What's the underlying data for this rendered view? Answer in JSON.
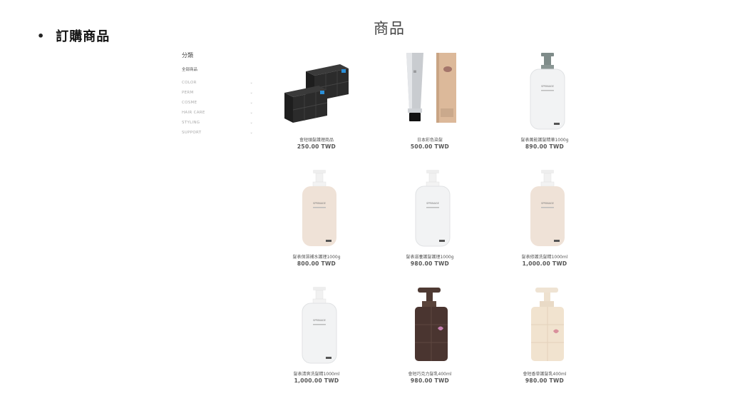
{
  "heading": {
    "bullet": "•",
    "text": "訂購商品"
  },
  "page_title": "商品",
  "sidebar": {
    "title": "分類",
    "all_label": "全部商品",
    "items": [
      {
        "label": "COLOR"
      },
      {
        "label": "PERM"
      },
      {
        "label": "COSME"
      },
      {
        "label": "HAIR CARE"
      },
      {
        "label": "STYLING"
      },
      {
        "label": "SUPPORT"
      }
    ]
  },
  "products": [
    {
      "name": "會短頭髮護理商品",
      "price": "250.00 TWD",
      "image": "black-wax-boxes"
    },
    {
      "name": "日本彩色染髮",
      "price": "500.00 TWD",
      "image": "dye-tube-box"
    },
    {
      "name": "髮表萬能護髮精華1000g",
      "price": "890.00 TWD",
      "image": "white-pump-bottle-grey"
    },
    {
      "name": "髮表保濕補水護理1000g",
      "price": "800.00 TWD",
      "image": "beige-pump-bottle"
    },
    {
      "name": "髮表滋養護髮護理1000g",
      "price": "980.00 TWD",
      "image": "white-pump-bottle"
    },
    {
      "name": "髮表修護洗髮精1000ml",
      "price": "1,000.00 TWD",
      "image": "beige-pump-bottle"
    },
    {
      "name": "髮表清爽洗髮精1000ml",
      "price": "1,000.00 TWD",
      "image": "white-pump-bottle"
    },
    {
      "name": "會短巧克力髮乳400ml",
      "price": "980.00 TWD",
      "image": "brown-square-pump"
    },
    {
      "name": "會短香草護髮乳400ml",
      "price": "980.00 TWD",
      "image": "cream-square-pump"
    }
  ],
  "colors": {
    "text": "#555555",
    "muted": "#aaaaaa",
    "heading": "#111111"
  }
}
